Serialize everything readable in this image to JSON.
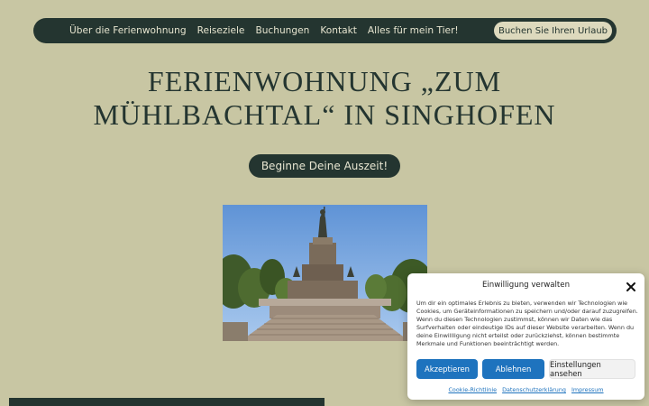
{
  "nav": {
    "items": [
      {
        "label": "Über die Ferienwohnung"
      },
      {
        "label": "Reiseziele"
      },
      {
        "label": "Buchungen"
      },
      {
        "label": "Kontakt"
      },
      {
        "label": "Alles für mein Tier!"
      }
    ],
    "cta_label": "Buchen Sie Ihren Urlaub"
  },
  "hero": {
    "title_line1": "FERIENWOHNUNG „ZUM",
    "title_line2": "MÜHLBACHTAL“ IN SINGHOFEN",
    "button_label": "Beginne Deine Auszeit!"
  },
  "cookie": {
    "title": "Einwilligung verwalten",
    "text": "Um dir ein optimales Erlebnis zu bieten, verwenden wir Technologien wie Cookies, um Geräteinformationen zu speichern und/oder darauf zuzugreifen. Wenn du diesen Technologien zustimmst, können wir Daten wie das Surfverhalten oder eindeutige IDs auf dieser Website verarbeiten. Wenn du deine Einwillligung nicht erteilst oder zurückziehst, können bestimmte Merkmale und Funktionen beeinträchtigt werden.",
    "accept_label": "Akzeptieren",
    "deny_label": "Ablehnen",
    "settings_label": "Einstellungen ansehen",
    "links": [
      {
        "label": "Cookie-Richtlinie"
      },
      {
        "label": "Datenschutzerklärung"
      },
      {
        "label": "Impressum"
      }
    ]
  },
  "colors": {
    "background": "#c8c6a3",
    "dark": "#243530",
    "accent_blue": "#1e73be"
  }
}
